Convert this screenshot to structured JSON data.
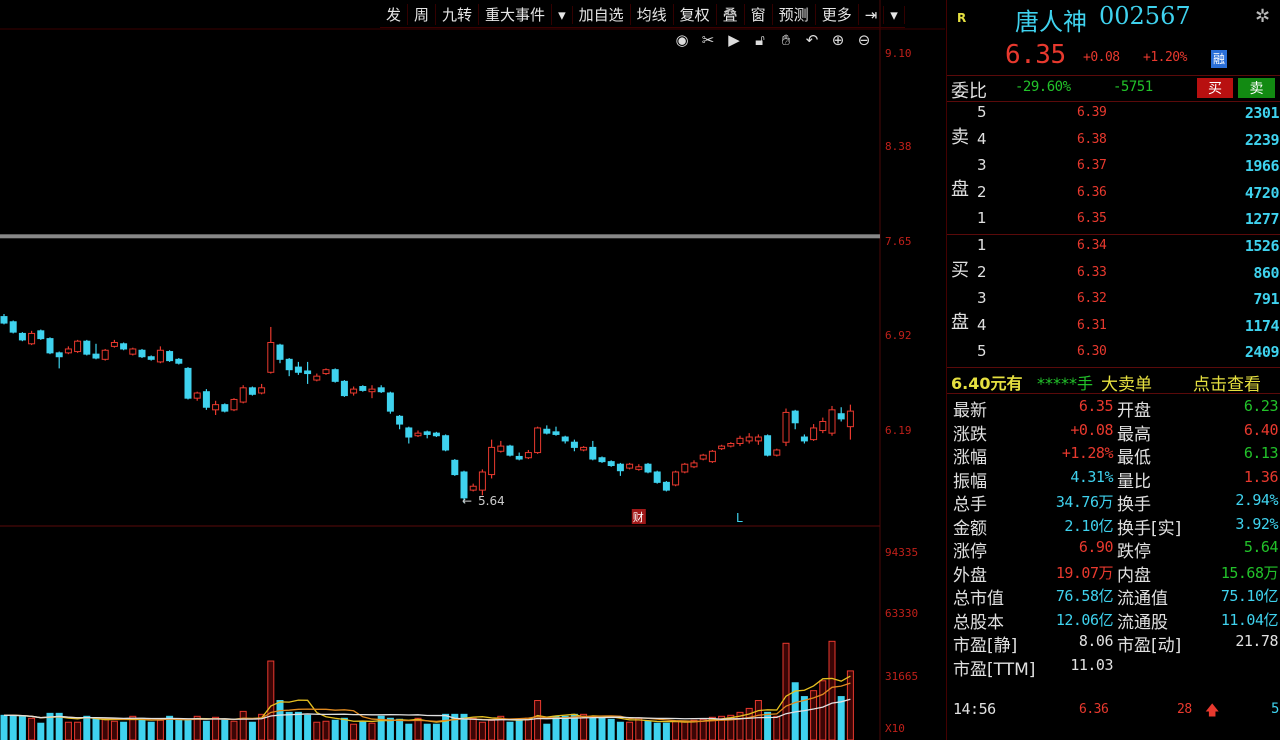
{
  "toolbar": {
    "items": [
      "发",
      "周",
      "九转",
      "重大事件",
      "▾",
      "加自选",
      "均线",
      "复权",
      "叠",
      "窗",
      "预测",
      "更多",
      "⇥",
      "▾"
    ]
  },
  "chart_tools": [
    "eye-icon",
    "scissors-icon",
    "play-icon",
    "lock-icon",
    "hand-icon",
    "undo-icon",
    "zoom-in-icon",
    "zoom-out-icon"
  ],
  "colors": {
    "up": "#e8392e",
    "down": "#3fd2ee",
    "ma1": "#e0e0e0",
    "ma2": "#e6c020",
    "ma3": "#e08a20"
  },
  "chart_data": {
    "type": "candlestick",
    "price_axis_ticks": [
      "9.10",
      "8.38",
      "7.65",
      "6.92",
      "6.19"
    ],
    "price_axis_values": [
      9.1,
      8.38,
      7.65,
      6.92,
      6.19
    ],
    "volume_axis_ticks": [
      "94335",
      "63330",
      "31665",
      "X10"
    ],
    "volume_axis_values": [
      94335,
      63330,
      31665,
      0
    ],
    "low_annotation": "5.64",
    "markers": [
      {
        "text": "财",
        "candle": 69
      },
      {
        "text": "L",
        "candle": 80
      }
    ],
    "reference_line": 7.7,
    "ohlc": [
      [
        7.08,
        7.1,
        7.02,
        7.03
      ],
      [
        7.04,
        7.05,
        6.95,
        6.96
      ],
      [
        6.95,
        6.96,
        6.89,
        6.9
      ],
      [
        6.87,
        6.97,
        6.86,
        6.95
      ],
      [
        6.97,
        6.98,
        6.9,
        6.91
      ],
      [
        6.91,
        6.92,
        6.79,
        6.8
      ],
      [
        6.8,
        6.81,
        6.68,
        6.77
      ],
      [
        6.8,
        6.85,
        6.79,
        6.83
      ],
      [
        6.81,
        6.9,
        6.8,
        6.89
      ],
      [
        6.89,
        6.9,
        6.78,
        6.79
      ],
      [
        6.79,
        6.87,
        6.75,
        6.76
      ],
      [
        6.75,
        6.83,
        6.74,
        6.82
      ],
      [
        6.85,
        6.9,
        6.84,
        6.88
      ],
      [
        6.87,
        6.88,
        6.82,
        6.83
      ],
      [
        6.79,
        6.84,
        6.78,
        6.83
      ],
      [
        6.82,
        6.83,
        6.76,
        6.77
      ],
      [
        6.77,
        6.78,
        6.74,
        6.75
      ],
      [
        6.73,
        6.85,
        6.72,
        6.82
      ],
      [
        6.81,
        6.82,
        6.73,
        6.74
      ],
      [
        6.75,
        6.76,
        6.71,
        6.72
      ],
      [
        6.68,
        6.69,
        6.44,
        6.45
      ],
      [
        6.45,
        6.5,
        6.43,
        6.49
      ],
      [
        6.5,
        6.52,
        6.36,
        6.38
      ],
      [
        6.36,
        6.43,
        6.32,
        6.4
      ],
      [
        6.4,
        6.41,
        6.34,
        6.35
      ],
      [
        6.36,
        6.45,
        6.35,
        6.44
      ],
      [
        6.42,
        6.55,
        6.41,
        6.53
      ],
      [
        6.53,
        6.54,
        6.47,
        6.48
      ],
      [
        6.49,
        6.56,
        6.48,
        6.53
      ],
      [
        6.65,
        7.0,
        6.64,
        6.88
      ],
      [
        6.86,
        6.87,
        6.72,
        6.75
      ],
      [
        6.75,
        6.76,
        6.62,
        6.67
      ],
      [
        6.69,
        6.73,
        6.63,
        6.65
      ],
      [
        6.66,
        6.73,
        6.56,
        6.64
      ],
      [
        6.59,
        6.64,
        6.58,
        6.62
      ],
      [
        6.64,
        6.68,
        6.63,
        6.67
      ],
      [
        6.67,
        6.68,
        6.57,
        6.58
      ],
      [
        6.58,
        6.59,
        6.46,
        6.47
      ],
      [
        6.49,
        6.54,
        6.47,
        6.52
      ],
      [
        6.54,
        6.55,
        6.5,
        6.51
      ],
      [
        6.5,
        6.55,
        6.45,
        6.52
      ],
      [
        6.53,
        6.55,
        6.49,
        6.5
      ],
      [
        6.49,
        6.5,
        6.33,
        6.35
      ],
      [
        6.31,
        6.32,
        6.21,
        6.25
      ],
      [
        6.22,
        6.23,
        6.1,
        6.15
      ],
      [
        6.16,
        6.2,
        6.15,
        6.18
      ],
      [
        6.19,
        6.2,
        6.14,
        6.17
      ],
      [
        6.18,
        6.19,
        6.15,
        6.16
      ],
      [
        6.16,
        6.17,
        6.04,
        6.05
      ],
      [
        5.97,
        5.98,
        5.85,
        5.86
      ],
      [
        5.88,
        5.89,
        5.64,
        5.68
      ],
      [
        5.74,
        5.79,
        5.73,
        5.77
      ],
      [
        5.74,
        5.9,
        5.7,
        5.88
      ],
      [
        5.86,
        6.13,
        5.83,
        6.07
      ],
      [
        6.04,
        6.12,
        6.03,
        6.08
      ],
      [
        6.08,
        6.09,
        6.0,
        6.01
      ],
      [
        6.0,
        6.03,
        5.97,
        5.98
      ],
      [
        5.99,
        6.05,
        5.98,
        6.03
      ],
      [
        6.03,
        6.23,
        6.02,
        6.22
      ],
      [
        6.21,
        6.24,
        6.17,
        6.18
      ],
      [
        6.19,
        6.23,
        6.16,
        6.17
      ],
      [
        6.15,
        6.16,
        6.1,
        6.12
      ],
      [
        6.11,
        6.13,
        6.04,
        6.07
      ],
      [
        6.05,
        6.08,
        6.04,
        6.07
      ],
      [
        6.07,
        6.12,
        5.97,
        5.98
      ],
      [
        5.99,
        6.0,
        5.95,
        5.96
      ],
      [
        5.96,
        5.97,
        5.92,
        5.93
      ],
      [
        5.94,
        5.95,
        5.85,
        5.89
      ],
      [
        5.91,
        5.95,
        5.9,
        5.94
      ],
      [
        5.9,
        5.94,
        5.89,
        5.92
      ],
      [
        5.94,
        5.95,
        5.87,
        5.88
      ],
      [
        5.88,
        5.89,
        5.79,
        5.8
      ],
      [
        5.8,
        5.81,
        5.73,
        5.74
      ],
      [
        5.78,
        5.89,
        5.77,
        5.88
      ],
      [
        5.88,
        5.95,
        5.87,
        5.94
      ],
      [
        5.92,
        5.97,
        5.91,
        5.95
      ],
      [
        5.98,
        6.02,
        5.97,
        6.01
      ],
      [
        5.96,
        6.05,
        5.95,
        6.04
      ],
      [
        6.06,
        6.09,
        6.05,
        6.08
      ],
      [
        6.08,
        6.11,
        6.07,
        6.1
      ],
      [
        6.1,
        6.16,
        6.08,
        6.14
      ],
      [
        6.12,
        6.18,
        6.1,
        6.15
      ],
      [
        6.12,
        6.17,
        6.09,
        6.15
      ],
      [
        6.16,
        6.17,
        6.0,
        6.01
      ],
      [
        6.01,
        6.06,
        6.0,
        6.05
      ],
      [
        6.11,
        6.37,
        6.08,
        6.34
      ],
      [
        6.35,
        6.36,
        6.21,
        6.26
      ],
      [
        6.15,
        6.17,
        6.1,
        6.12
      ],
      [
        6.13,
        6.25,
        6.12,
        6.22
      ],
      [
        6.2,
        6.3,
        6.18,
        6.27
      ],
      [
        6.18,
        6.39,
        6.16,
        6.36
      ],
      [
        6.33,
        6.38,
        6.27,
        6.29
      ],
      [
        6.23,
        6.4,
        6.13,
        6.35
      ]
    ],
    "volume": [
      12500,
      12500,
      12000,
      11000,
      8500,
      13500,
      13500,
      9000,
      9000,
      12000,
      11000,
      10500,
      9500,
      9000,
      12000,
      11000,
      9000,
      10000,
      12000,
      10000,
      10500,
      12000,
      9500,
      11500,
      10000,
      9500,
      14500,
      9000,
      13000,
      40000,
      20000,
      14000,
      14000,
      12500,
      9000,
      9500,
      10000,
      11000,
      8000,
      9500,
      8500,
      12000,
      11000,
      10500,
      8000,
      11000,
      8000,
      8000,
      13000,
      13000,
      13000,
      11000,
      9000,
      10000,
      12000,
      9000,
      10000,
      11000,
      20000,
      8000,
      12000,
      12000,
      13000,
      13000,
      11000,
      11500,
      10500,
      9000,
      9000,
      11000,
      9500,
      8500,
      8500,
      9500,
      9500,
      10000,
      10500,
      11500,
      12000,
      12500,
      14000,
      16000,
      20000,
      14000,
      12000,
      49000,
      29000,
      22000,
      25000,
      30000,
      50000,
      22000,
      35000
    ]
  },
  "quote": {
    "r_badge": "R",
    "name": "唐人神",
    "code": "002567",
    "price": "6.35",
    "change": "+0.08",
    "change_pct": "+1.20%",
    "badge": "融",
    "wb_label": "委比",
    "wb_pct": "-29.60%",
    "wb_diff": "-5751",
    "buy_btn": "买",
    "sell_btn": "卖",
    "sell_side_label": [
      "卖",
      "盘"
    ],
    "buy_side_label": [
      "买",
      "盘"
    ],
    "asks": [
      {
        "lvl": "5",
        "price": "6.39",
        "vol": "2301"
      },
      {
        "lvl": "4",
        "price": "6.38",
        "vol": "2239"
      },
      {
        "lvl": "3",
        "price": "6.37",
        "vol": "1966"
      },
      {
        "lvl": "2",
        "price": "6.36",
        "vol": "4720"
      },
      {
        "lvl": "1",
        "price": "6.35",
        "vol": "1277"
      }
    ],
    "bids": [
      {
        "lvl": "1",
        "price": "6.34",
        "vol": "1526"
      },
      {
        "lvl": "2",
        "price": "6.33",
        "vol": "860"
      },
      {
        "lvl": "3",
        "price": "6.32",
        "vol": "791"
      },
      {
        "lvl": "4",
        "price": "6.31",
        "vol": "1174"
      },
      {
        "lvl": "5",
        "price": "6.30",
        "vol": "2409"
      }
    ],
    "big_order": {
      "price": "6.40元有",
      "qty": "*****手",
      "type": "大卖单",
      "link": "点击查看"
    },
    "stats": [
      {
        "l1": "最新",
        "v1": "6.35",
        "c1": "r",
        "l2": "开盘",
        "v2": "6.23",
        "c2": "g"
      },
      {
        "l1": "涨跌",
        "v1": "+0.08",
        "c1": "r",
        "l2": "最高",
        "v2": "6.40",
        "c2": "r"
      },
      {
        "l1": "涨幅",
        "v1": "+1.28%",
        "c1": "r",
        "l2": "最低",
        "v2": "6.13",
        "c2": "g"
      },
      {
        "l1": "振幅",
        "v1": "4.31%",
        "c1": "c",
        "l2": "量比",
        "v2": "1.36",
        "c2": "r"
      },
      {
        "l1": "总手",
        "v1": "34.76万",
        "c1": "c",
        "l2": "换手",
        "v2": "2.94%",
        "c2": "c"
      },
      {
        "l1": "金额",
        "v1": "2.10亿",
        "c1": "c",
        "l2": "换手[实]",
        "v2": "3.92%",
        "c2": "c"
      },
      {
        "l1": "涨停",
        "v1": "6.90",
        "c1": "r",
        "l2": "跌停",
        "v2": "5.64",
        "c2": "g"
      },
      {
        "l1": "外盘",
        "v1": "19.07万",
        "c1": "r",
        "l2": "内盘",
        "v2": "15.68万",
        "c2": "g"
      },
      {
        "l1": "总市值",
        "v1": "76.58亿",
        "c1": "c",
        "l2": "流通值",
        "v2": "75.10亿",
        "c2": "c"
      },
      {
        "l1": "总股本",
        "v1": "12.06亿",
        "c1": "c",
        "l2": "流通股",
        "v2": "11.04亿",
        "c2": "c"
      },
      {
        "l1": "市盈[静]",
        "v1": "8.06",
        "c1": "w",
        "l2": "市盈[动]",
        "v2": "21.78",
        "c2": "w"
      },
      {
        "l1": "市盈[TTM]",
        "v1": "11.03",
        "c1": "w",
        "l2": "",
        "v2": "",
        "c2": "w"
      }
    ],
    "tick": {
      "time": "14:56",
      "price": "6.36",
      "vol": "28",
      "arrow": "arrow-up-icon",
      "count": "5"
    }
  }
}
